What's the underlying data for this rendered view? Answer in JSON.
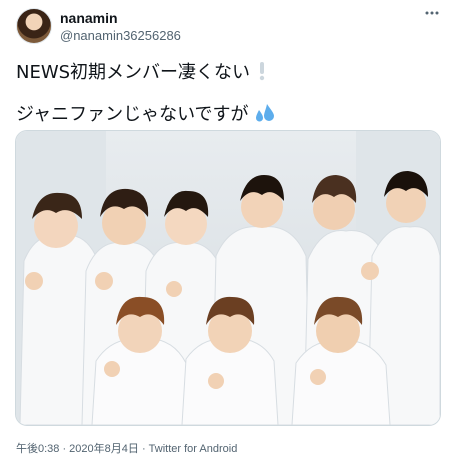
{
  "tweet": {
    "display_name": "nanamin",
    "handle": "@nanamin36256286",
    "more_icon": "more-horizontal-icon",
    "text_line1": "NEWS初期メンバー凄くない",
    "text_line1_emoji": "white-exclamation-mark",
    "text_line2": "ジャニファンじゃないですが",
    "text_line2_emoji": "sweat-droplets",
    "timestamp": "午後0:38 · 2020年8月4日 · Twitter for Android"
  },
  "colors": {
    "text": "#0f1419",
    "secondary": "#536471",
    "droplet": "#5dadec"
  }
}
